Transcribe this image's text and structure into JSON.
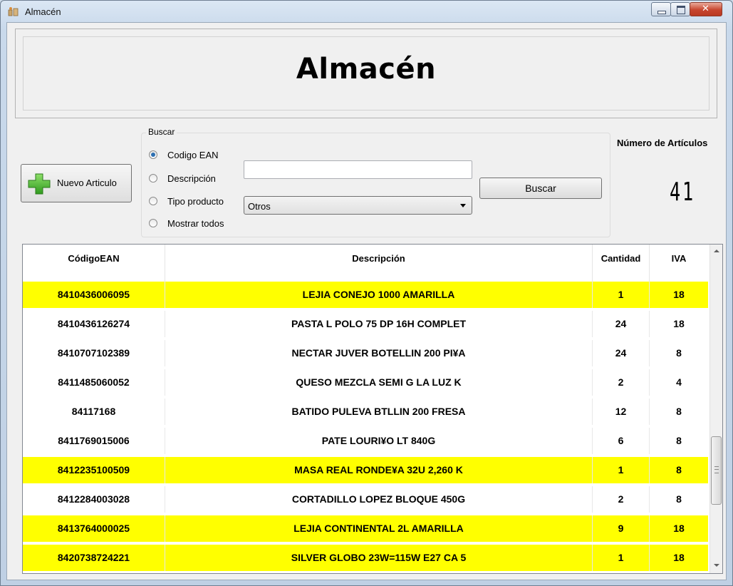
{
  "window": {
    "title": "Almacén",
    "controls": {
      "minimize_icon": "minimize-icon",
      "maximize_icon": "maximize-icon",
      "close_icon": "close-icon"
    }
  },
  "header": {
    "heading": "Almacén"
  },
  "toolbar": {
    "new_article_label": "Nuevo Articulo"
  },
  "search": {
    "group_title": "Buscar",
    "options": [
      {
        "label": "Codigo EAN",
        "selected": true
      },
      {
        "label": "Descripción",
        "selected": false
      },
      {
        "label": "Tipo producto",
        "selected": false
      },
      {
        "label": "Mostrar todos",
        "selected": false
      }
    ],
    "input_value": "",
    "type_selected": "Otros",
    "button_label": "Buscar"
  },
  "stats": {
    "count_label": "Número de Artículos",
    "count_value": "41"
  },
  "table": {
    "columns": [
      "CódigoEAN",
      "Descripción",
      "Cantidad",
      "IVA"
    ],
    "highlight_color": "#ffff00",
    "rows": [
      {
        "ean": "8410436006095",
        "desc": "LEJIA CONEJO 1000 AMARILLA",
        "qty": "1",
        "iva": "18",
        "highlight": true
      },
      {
        "ean": "8410436126274",
        "desc": "PASTA L POLO 75 DP 16H COMPLET",
        "qty": "24",
        "iva": "18",
        "highlight": false
      },
      {
        "ean": "8410707102389",
        "desc": "NECTAR JUVER BOTELLIN 200 PI¥A",
        "qty": "24",
        "iva": "8",
        "highlight": false
      },
      {
        "ean": "8411485060052",
        "desc": "QUESO MEZCLA SEMI G LA LUZ K",
        "qty": "2",
        "iva": "4",
        "highlight": false
      },
      {
        "ean": "84117168",
        "desc": "BATIDO PULEVA BTLLIN 200 FRESA",
        "qty": "12",
        "iva": "8",
        "highlight": false
      },
      {
        "ean": "8411769015006",
        "desc": "PATE LOURI¥O LT 840G",
        "qty": "6",
        "iva": "8",
        "highlight": false
      },
      {
        "ean": "8412235100509",
        "desc": "MASA REAL RONDE¥A 32U  2,260 K",
        "qty": "1",
        "iva": "8",
        "highlight": true
      },
      {
        "ean": "8412284003028",
        "desc": "CORTADILLO LOPEZ BLOQUE 450G",
        "qty": "2",
        "iva": "8",
        "highlight": false
      },
      {
        "ean": "8413764000025",
        "desc": "LEJIA CONTINENTAL 2L AMARILLA",
        "qty": "9",
        "iva": "18",
        "highlight": true
      },
      {
        "ean": "8420738724221",
        "desc": "SILVER GLOBO 23W=115W E27 CA 5",
        "qty": "1",
        "iva": "18",
        "highlight": true
      }
    ]
  }
}
